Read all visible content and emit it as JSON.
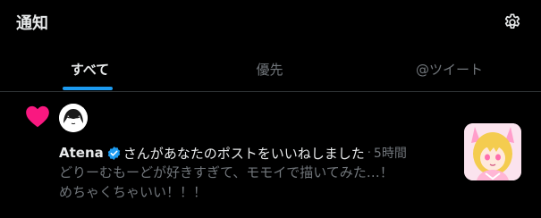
{
  "header": {
    "title": "通知",
    "settings_icon": "gear-icon"
  },
  "tabs": [
    {
      "label": "すべて",
      "active": true
    },
    {
      "label": "優先",
      "active": false
    },
    {
      "label": "@ツイート",
      "active": false
    }
  ],
  "notification": {
    "type_icon": "heart-icon",
    "user_name": "Atena",
    "verified_icon": "verified-badge-icon",
    "action_text": "さんがあなたのポストをいいねしました",
    "separator": "·",
    "time": "5時間",
    "tweet_lines": [
      "どりーむもーどが好きすぎて、モモイで描いてみた…！",
      "めちゃくちゃいい！！！"
    ]
  },
  "colors": {
    "background": "#000000",
    "text_primary": "#e7e9ea",
    "text_secondary": "#71767b",
    "accent": "#1d9bf0",
    "heart": "#f91880",
    "divider": "#2f3336"
  }
}
